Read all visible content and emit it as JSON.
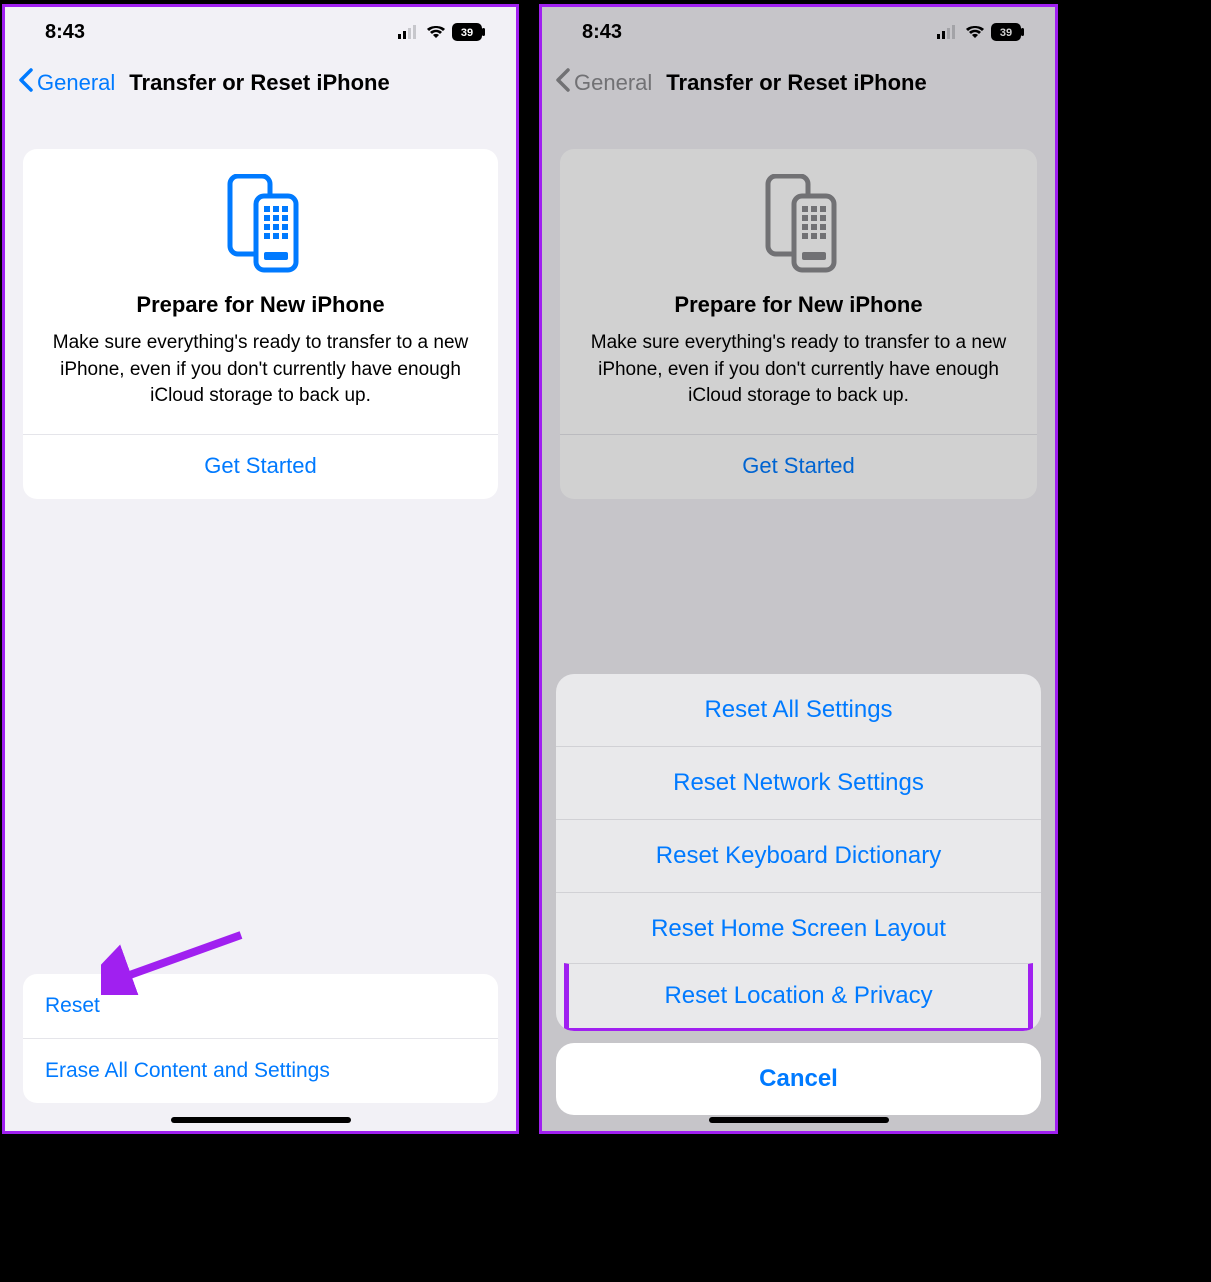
{
  "status": {
    "time": "8:43",
    "battery": "39"
  },
  "nav": {
    "back": "General",
    "title": "Transfer or Reset iPhone"
  },
  "prepare": {
    "title": "Prepare for New iPhone",
    "desc": "Make sure everything's ready to transfer to a new iPhone, even if you don't currently have enough iCloud storage to back up.",
    "cta": "Get Started"
  },
  "options": {
    "reset": "Reset",
    "erase": "Erase All Content and Settings"
  },
  "sheet": {
    "items": [
      "Reset All Settings",
      "Reset Network Settings",
      "Reset Keyboard Dictionary",
      "Reset Home Screen Layout",
      "Reset Location & Privacy"
    ],
    "cancel": "Cancel"
  },
  "colors": {
    "accent": "#007aff",
    "annotation": "#a020f0"
  }
}
